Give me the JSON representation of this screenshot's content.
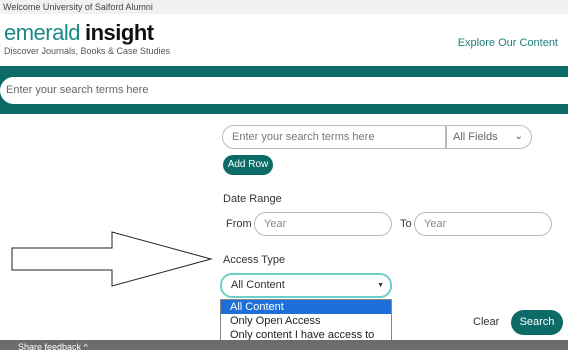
{
  "header": {
    "welcome": "Welcome University of Salford Alumni",
    "logo_part1": "emerald",
    "logo_part2": "insight",
    "tagline": "Discover Journals, Books & Case Studies",
    "explore_link": "Explore Our Content"
  },
  "main_search": {
    "placeholder": "Enter your search terms here"
  },
  "advanced": {
    "search_placeholder": "Enter your search terms here",
    "field_select": "All Fields",
    "add_row": "Add Row",
    "date_range_label": "Date Range",
    "from_label": "From",
    "from_placeholder": "Year",
    "to_label": "To",
    "to_placeholder": "Year",
    "access_type_label": "Access Type",
    "access_selected": "All Content",
    "access_options": [
      "All Content",
      "Only Open Access",
      "Only content I have access to"
    ],
    "clear": "Clear",
    "search": "Search"
  },
  "footer": {
    "feedback": "Share feedback ^"
  },
  "colors": {
    "brand_teal": "#0c6b67",
    "focus_outline": "#6ecfc9",
    "dropdown_highlight": "#1e6fd9"
  },
  "icons": [
    "chevron-down-icon",
    "caret-down-icon",
    "arrow-right-icon"
  ]
}
